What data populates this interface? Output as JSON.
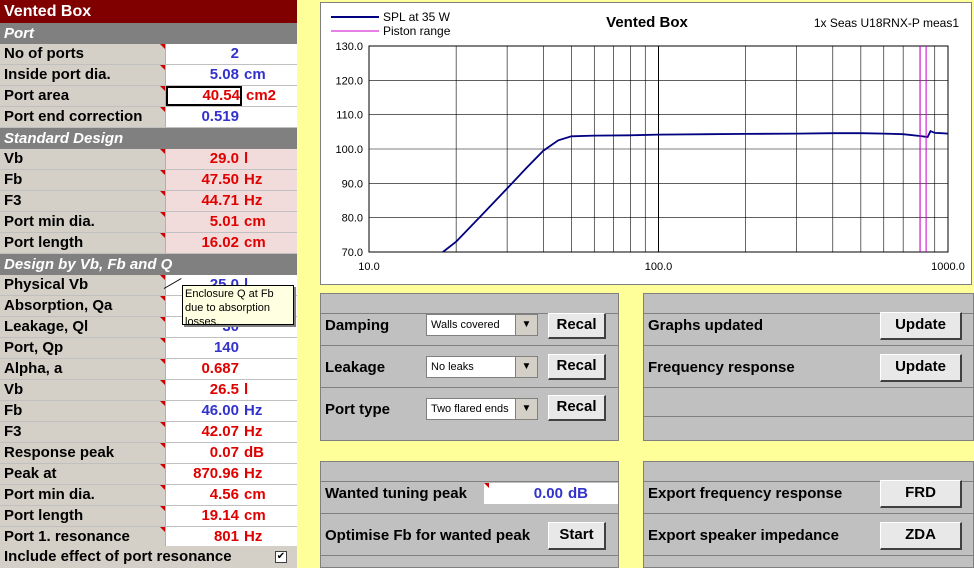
{
  "left": {
    "title": "Vented Box",
    "sections": {
      "port": "Port",
      "standard": "Standard Design",
      "design_vfq": "Design by Vb, Fb and Q"
    },
    "port": [
      {
        "label": "No of ports",
        "value": "2",
        "unit": ""
      },
      {
        "label": "Inside port dia.",
        "value": "5.08",
        "unit": "cm"
      },
      {
        "label": "Port area",
        "value": "40.54",
        "unit": "cm2"
      },
      {
        "label": "Port end correction",
        "value": "0.519",
        "unit": ""
      }
    ],
    "standard": [
      {
        "label": "Vb",
        "value": "29.0",
        "unit": "l"
      },
      {
        "label": "Fb",
        "value": "47.50",
        "unit": "Hz"
      },
      {
        "label": "F3",
        "value": "44.71",
        "unit": "Hz"
      },
      {
        "label": "Port min dia.",
        "value": "5.01",
        "unit": "cm"
      },
      {
        "label": "Port length",
        "value": "16.02",
        "unit": "cm"
      }
    ],
    "design": [
      {
        "label": "Physical Vb",
        "value": "25.0",
        "unit": "l"
      },
      {
        "label": "Absorption, Qa",
        "value": "",
        "unit": ""
      },
      {
        "label": "Leakage, Ql",
        "value": "30",
        "unit": ""
      },
      {
        "label": "Port, Qp",
        "value": "140",
        "unit": ""
      },
      {
        "label": "Alpha, a",
        "value": "0.687",
        "unit": ""
      },
      {
        "label": "Vb",
        "value": "26.5",
        "unit": "l"
      },
      {
        "label": "Fb",
        "value": "46.00",
        "unit": "Hz"
      },
      {
        "label": "F3",
        "value": "42.07",
        "unit": "Hz"
      },
      {
        "label": "Response peak",
        "value": "0.07",
        "unit": "dB"
      },
      {
        "label": "Peak at",
        "value": "870.96",
        "unit": "Hz"
      },
      {
        "label": "Port min dia.",
        "value": "4.56",
        "unit": "cm"
      },
      {
        "label": "Port length",
        "value": "19.14",
        "unit": "cm"
      },
      {
        "label": "Port 1. resonance",
        "value": "801",
        "unit": "Hz"
      }
    ],
    "include_label": "Include effect of port resonance",
    "include_checked": true,
    "tooltip": "Enclosure Q at Fb due to absorption losses."
  },
  "chart_data": {
    "type": "line",
    "title": "Vented Box",
    "subtitle": "1x Seas U18RNX-P  meas1",
    "xscale": "log",
    "xlim": [
      10,
      1000
    ],
    "ylim": [
      70,
      130
    ],
    "xticks": [
      "10.0",
      "100.0",
      "1000.0"
    ],
    "yticks": [
      "70.0",
      "80.0",
      "90.0",
      "100.0",
      "110.0",
      "120.0",
      "130.0"
    ],
    "grid": true,
    "legend": "top-left",
    "series": [
      {
        "name": "SPL at 35 W",
        "color": "#000080",
        "x": [
          18,
          20,
          25,
          30,
          35,
          40,
          45,
          50,
          60,
          80,
          100,
          150,
          200,
          300,
          400,
          500,
          600,
          700,
          800,
          850,
          870,
          900,
          950,
          1000
        ],
        "y": [
          70.0,
          73.0,
          81.5,
          88.5,
          94.5,
          99.5,
          102.5,
          103.7,
          103.9,
          104.0,
          104.2,
          104.3,
          104.4,
          104.5,
          104.6,
          104.6,
          104.5,
          104.3,
          103.8,
          103.5,
          105.2,
          104.7,
          104.6,
          104.5
        ]
      },
      {
        "name": "Piston range",
        "color": "#cc00cc",
        "x": [
          801,
          801
        ],
        "y": [
          70,
          130
        ]
      }
    ]
  },
  "settings": {
    "damping": {
      "label": "Damping",
      "value": "Walls covered",
      "button": "Recal"
    },
    "leakage": {
      "label": "Leakage",
      "value": "No leaks",
      "button": "Recal"
    },
    "port_type": {
      "label": "Port type",
      "value": "Two flared ends",
      "button": "Recal"
    }
  },
  "updates": {
    "graphs": {
      "label": "Graphs updated",
      "button": "Update"
    },
    "freq": {
      "label": "Frequency response",
      "button": "Update"
    }
  },
  "tuning": {
    "wanted_label": "Wanted tuning peak",
    "wanted_value": "0.00",
    "wanted_unit": "dB",
    "optimise_label": "Optimise Fb for wanted peak",
    "optimise_button": "Start"
  },
  "export": {
    "freq": {
      "label": "Export frequency response",
      "button": "FRD"
    },
    "imp": {
      "label": "Export speaker impedance",
      "button": "ZDA"
    }
  }
}
